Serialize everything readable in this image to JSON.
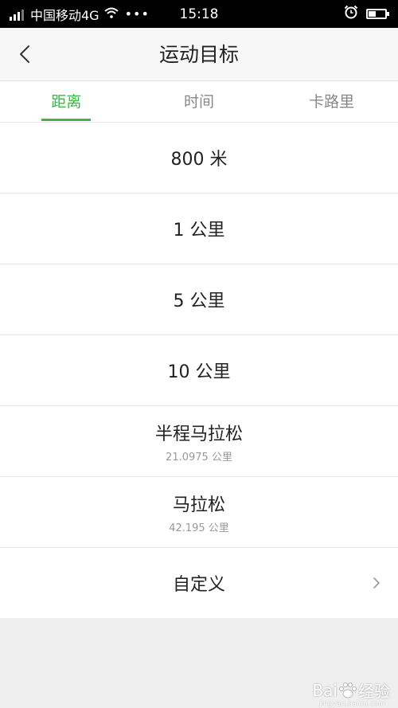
{
  "status_bar": {
    "carrier": "中国移动4G",
    "more": "•••",
    "time": "15:18",
    "battery_level": 0.45
  },
  "nav": {
    "title": "运动目标"
  },
  "tabs": [
    {
      "label": "距离",
      "active": true
    },
    {
      "label": "时间",
      "active": false
    },
    {
      "label": "卡路里",
      "active": false
    }
  ],
  "items": [
    {
      "title": "800 米",
      "subtitle": ""
    },
    {
      "title": "1 公里",
      "subtitle": ""
    },
    {
      "title": "5 公里",
      "subtitle": ""
    },
    {
      "title": "10 公里",
      "subtitle": ""
    },
    {
      "title": "半程马拉松",
      "subtitle": "21.0975 公里"
    },
    {
      "title": "马拉松",
      "subtitle": "42.195 公里"
    },
    {
      "title": "自定义",
      "subtitle": ""
    }
  ],
  "watermark": {
    "brand": "Bai",
    "brand_suffix": "经验",
    "url": "jingyan.baidu.com"
  }
}
